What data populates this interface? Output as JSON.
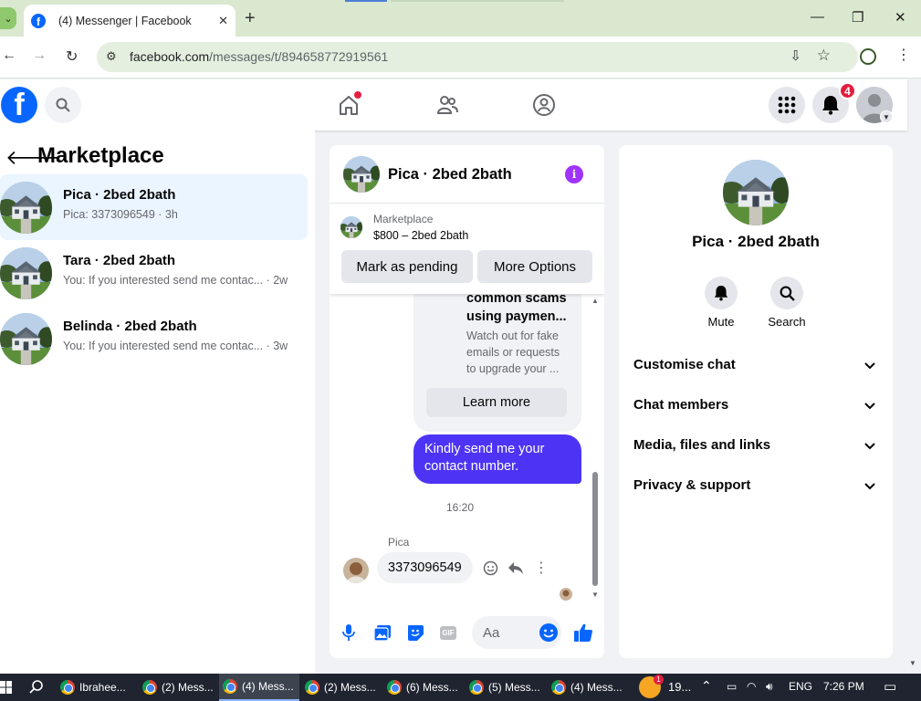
{
  "browser": {
    "tab_title": "(4) Messenger | Facebook",
    "tab_close": "✕",
    "new_tab": "+",
    "url_host": "facebook.com",
    "url_path": "/messages/t/894658772919561",
    "window_controls": [
      "—",
      "❐",
      "✕"
    ]
  },
  "fb_header": {
    "logo": "f",
    "notification_count": "4"
  },
  "left_panel": {
    "title": "Marketplace",
    "conversations": [
      {
        "name": "Pica · 2bed 2bath",
        "preview": "Pica: 3373096549 · 3h",
        "active": true
      },
      {
        "name": "Tara · 2bed 2bath",
        "preview": "You: If you interested send me contac... · 2w",
        "active": false
      },
      {
        "name": "Belinda · 2bed 2bath",
        "preview": "You: If you interested send me contac... · 3w",
        "active": false
      }
    ]
  },
  "chat": {
    "header_name": "Pica · 2bed 2bath",
    "info_glyph": "i",
    "marketplace_label": "Marketplace",
    "listing_price": "$800 – 2bed 2bath",
    "mark_pending_label": "Mark as pending",
    "more_options_label": "More Options",
    "scam_title": "common scams using paymen...",
    "scam_desc": "Watch out for fake emails or requests to upgrade your ...",
    "learn_more_label": "Learn more",
    "outgoing_message": "Kindly send me your contact number.",
    "timestamp": "16:20",
    "sender_label": "Pica",
    "incoming_message": "3373096549",
    "composer_placeholder": "Aa",
    "composer_gif": "GIF"
  },
  "right_panel": {
    "name": "Pica · 2bed 2bath",
    "actions": [
      {
        "label": "Mute",
        "icon": "bell-icon"
      },
      {
        "label": "Search",
        "icon": "search-icon"
      }
    ],
    "sections": [
      "Customise chat",
      "Chat members",
      "Media, files and links",
      "Privacy & support"
    ]
  },
  "taskbar": {
    "items": [
      "Ibrahee...",
      "(2) Mess...",
      "(4) Mess...",
      "(2) Mess...",
      "(6) Mess...",
      "(5) Mess...",
      "(4) Mess..."
    ],
    "weather": "19...",
    "weather_badge": "1",
    "language": "ENG",
    "time": "7:26 PM"
  },
  "colors": {
    "fb_blue": "#0866ff",
    "messenger_purple": "#4d34f5",
    "active_conversation_bg": "#ebf5ff",
    "badge_red": "#e41e3f",
    "chrome_green": "#d9e8cf"
  }
}
